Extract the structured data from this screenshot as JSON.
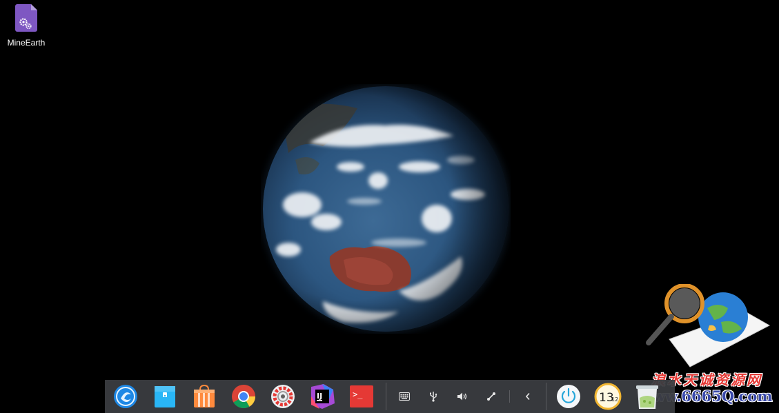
{
  "desktop": {
    "icons": [
      {
        "label": "MineEarth",
        "icon": "gear-file-icon"
      }
    ]
  },
  "dock": {
    "apps": [
      {
        "name": "launcher-icon"
      },
      {
        "name": "file-manager-icon"
      },
      {
        "name": "app-store-icon"
      },
      {
        "name": "chrome-icon"
      },
      {
        "name": "settings-icon"
      },
      {
        "name": "intellij-icon",
        "label": "IJ"
      },
      {
        "name": "terminal-icon",
        "label": ">_"
      }
    ],
    "tray": [
      {
        "name": "keyboard-icon"
      },
      {
        "name": "usb-icon"
      },
      {
        "name": "volume-icon"
      },
      {
        "name": "network-icon"
      },
      {
        "name": "chevron-left-icon"
      }
    ],
    "clock": {
      "hour": "13",
      "minute": "12"
    }
  },
  "watermark": {
    "line1": "浪水天诚资源网",
    "line2": "www.6665Q.com"
  },
  "colors": {
    "dock_bg": "#3a3c40",
    "accent_purple": "#7e57c2"
  }
}
